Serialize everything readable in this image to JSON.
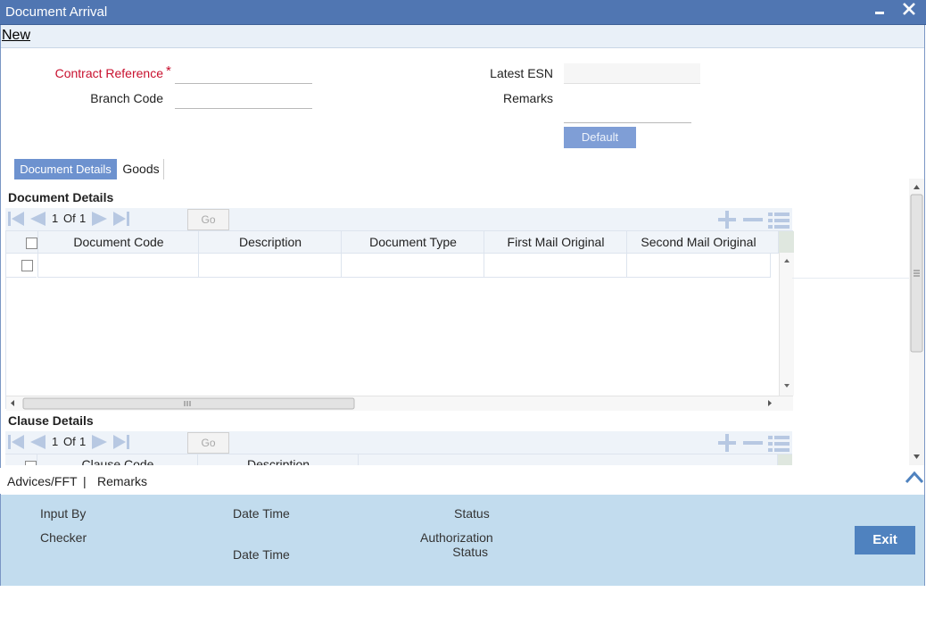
{
  "window": {
    "title": "Document Arrival",
    "minimize_label": "▬",
    "close_label": "✕"
  },
  "menu": {
    "new_label": "New"
  },
  "form": {
    "contract_reference_label": "Contract Reference",
    "required_marker": "*",
    "branch_code_label": "Branch Code",
    "latest_esn_label": "Latest ESN",
    "remarks_label": "Remarks",
    "default_button": "Default",
    "contract_reference_value": "",
    "branch_code_value": "",
    "latest_esn_value": "",
    "remarks_value": ""
  },
  "tabs": [
    {
      "label": "Document Details",
      "active": true
    },
    {
      "label": "Goods",
      "active": false
    }
  ],
  "document_details": {
    "title": "Document Details",
    "pagination": {
      "current": "1",
      "of_label": "Of",
      "total": "1",
      "go_label": "Go"
    },
    "columns": [
      "Document Code",
      "Description",
      "Document Type",
      "First Mail Original",
      "Second Mail Original"
    ],
    "rows": [
      {
        "document_code": "",
        "description": "",
        "document_type": "",
        "first_mail_original": "",
        "second_mail_original": ""
      }
    ]
  },
  "clause_details": {
    "title": "Clause Details",
    "pagination": {
      "current": "1",
      "of_label": "Of",
      "total": "1",
      "go_label": "Go"
    },
    "columns": [
      "Clause Code",
      "Description"
    ]
  },
  "footer": {
    "advices_label": "Advices/FFT",
    "separator": "|",
    "remarks_label": "Remarks"
  },
  "audit": {
    "input_by": "Input By",
    "date_time_1": "Date Time",
    "status": "Status",
    "checker": "Checker",
    "date_time_2": "Date Time",
    "authorization_status_line1": "Authorization",
    "authorization_status_line2": "Status",
    "exit_label": "Exit"
  },
  "colors": {
    "titlebar": "#5076b2",
    "accent": "#6d92cf",
    "audit_bg": "#c2dcee",
    "exit_bg": "#4f82bf",
    "required": "#c8102e"
  },
  "icons": [
    "first-page-icon",
    "prev-page-icon",
    "next-page-icon",
    "last-page-icon",
    "add-row-icon",
    "delete-row-icon",
    "single-view-icon",
    "collapse-icon"
  ]
}
